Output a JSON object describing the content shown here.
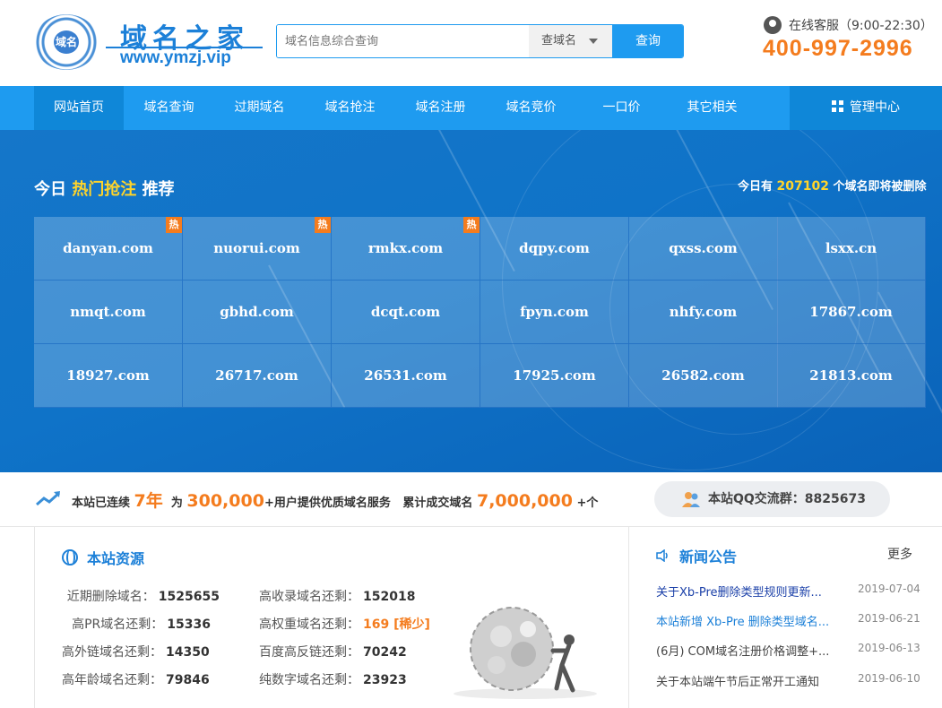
{
  "header": {
    "logo_emblem_text": "域名",
    "logo_title": "域名之家",
    "logo_url": "www.ymzj.vip",
    "search": {
      "placeholder": "域名信息综合查询",
      "select_value": "查域名",
      "button_label": "查询"
    },
    "customer_service": "在线客服（9:00-22:30）",
    "phone": "400-997-2996"
  },
  "nav": {
    "items": [
      "网站首页",
      "域名查询",
      "过期域名",
      "域名抢注",
      "域名注册",
      "域名竞价",
      "一口价",
      "其它相关"
    ],
    "active_index": 0,
    "admin_label": "管理中心"
  },
  "hot": {
    "title_pre": "今日",
    "title_hl": "热门抢注",
    "title_post": "推荐",
    "today_pre": "今日有",
    "today_count": "207102",
    "today_post": "个域名即将被删除",
    "badge_label": "热",
    "domains": [
      [
        "danyan.com",
        "nuorui.com",
        "rmkx.com",
        "dqpy.com",
        "qxss.com",
        "lsxx.cn"
      ],
      [
        "nmqt.com",
        "gbhd.com",
        "dcqt.com",
        "fpyn.com",
        "nhfy.com",
        "17867.com"
      ],
      [
        "18927.com",
        "26717.com",
        "26531.com",
        "17925.com",
        "26582.com",
        "21813.com"
      ]
    ],
    "hot_flags": [
      [
        true,
        true,
        true,
        false,
        false,
        false
      ],
      [
        false,
        false,
        false,
        false,
        false,
        false
      ],
      [
        false,
        false,
        false,
        false,
        false,
        false
      ]
    ]
  },
  "stats": {
    "p1": "本站已连续",
    "years": "7年",
    "p2": "为",
    "users": "300,000",
    "p3": "+用户提供优质域名服务",
    "p4": "累计成交域名",
    "deals": "7,000,000",
    "p5": "+个",
    "qq_label": "本站QQ交流群：8825673"
  },
  "resources": {
    "title": "本站资源",
    "rows": [
      {
        "label": "近期删除域名：",
        "value": "1525655"
      },
      {
        "label": "高收录域名还剩：",
        "value": "152018"
      },
      {
        "label": "高PR域名还剩：",
        "value": "15336"
      },
      {
        "label": "高权重域名还剩：",
        "value": "169 [稀少]"
      },
      {
        "label": "高外链域名还剩：",
        "value": "14350"
      },
      {
        "label": "百度高反链还剩：",
        "value": "70242"
      },
      {
        "label": "高年龄域名还剩：",
        "value": "79846"
      },
      {
        "label": "纯数字域名还剩：",
        "value": "23923"
      }
    ]
  },
  "news": {
    "title": "新闻公告",
    "more": "更多",
    "items": [
      {
        "title": "关于Xb-Pre删除类型规则更新...",
        "date": "2019-07-04",
        "color": "#1a3fa8"
      },
      {
        "title": "本站新增 Xb-Pre 删除类型域名...",
        "date": "2019-06-21",
        "color": "#1c80d8"
      },
      {
        "title": "(6月) COM域名注册价格调整+...",
        "date": "2019-06-13",
        "color": "#444444"
      },
      {
        "title": "关于本站端午节后正常开工通知",
        "date": "2019-06-10",
        "color": "#444444"
      }
    ]
  },
  "colors": {
    "primary": "#1e9bf0",
    "accent": "#f47c1e",
    "highlight": "#ffd42a"
  }
}
